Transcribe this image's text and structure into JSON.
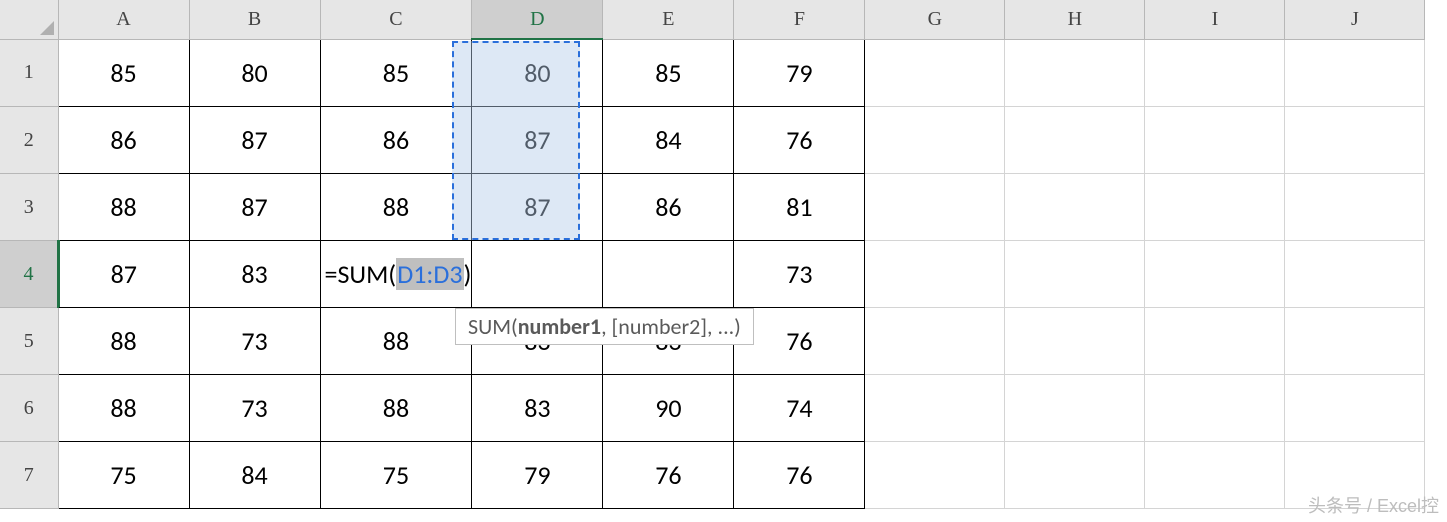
{
  "columns": [
    "A",
    "B",
    "C",
    "D",
    "E",
    "F",
    "G",
    "H",
    "I",
    "J"
  ],
  "rows": [
    "1",
    "2",
    "3",
    "4",
    "5",
    "6",
    "7"
  ],
  "activeCol": "D",
  "activeRow": "4",
  "cells": {
    "r1": {
      "A": "85",
      "B": "80",
      "C": "85",
      "D": "80",
      "E": "85",
      "F": "79"
    },
    "r2": {
      "A": "86",
      "B": "87",
      "C": "86",
      "D": "87",
      "E": "84",
      "F": "76"
    },
    "r3": {
      "A": "88",
      "B": "87",
      "C": "88",
      "D": "87",
      "E": "86",
      "F": "81"
    },
    "r4": {
      "A": "87",
      "B": "83",
      "C": "",
      "D": "",
      "E": "",
      "F": "73"
    },
    "r5": {
      "A": "88",
      "B": "73",
      "C": "88",
      "D": "83",
      "E": "83",
      "F": "76"
    },
    "r6": {
      "A": "88",
      "B": "73",
      "C": "88",
      "D": "83",
      "E": "90",
      "F": "74"
    },
    "r7": {
      "A": "75",
      "B": "84",
      "C": "75",
      "D": "79",
      "E": "76",
      "F": "76"
    }
  },
  "formula": {
    "prefix": "=SUM(",
    "ref": "D1:D3",
    "suffix": ")"
  },
  "tooltip": {
    "fn": "SUM(",
    "arg1": "number1",
    "rest": ", [number2], ...)"
  },
  "watermark": "头条号 / Excel控"
}
